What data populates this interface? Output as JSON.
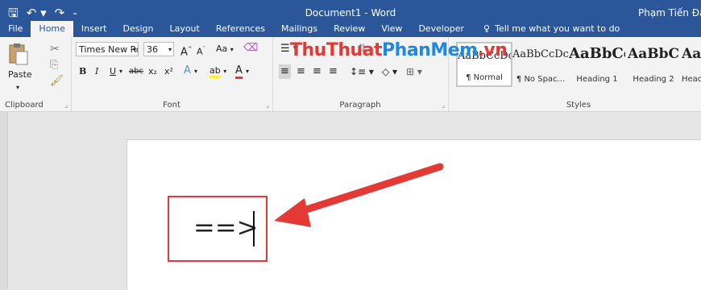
{
  "window": {
    "doc_title": "Document1 - Word",
    "user": "Phạm Tiến Đạt"
  },
  "tabs": [
    {
      "label": "File",
      "active": false
    },
    {
      "label": "Home",
      "active": true
    },
    {
      "label": "Insert",
      "active": false
    },
    {
      "label": "Design",
      "active": false
    },
    {
      "label": "Layout",
      "active": false
    },
    {
      "label": "References",
      "active": false
    },
    {
      "label": "Mailings",
      "active": false
    },
    {
      "label": "Review",
      "active": false
    },
    {
      "label": "View",
      "active": false
    },
    {
      "label": "Developer",
      "active": false
    }
  ],
  "tell_me": "Tell me what you want to do",
  "clipboard": {
    "label": "Clipboard",
    "paste": "Paste"
  },
  "font": {
    "label": "Font",
    "name": "Times New Ro",
    "size": "36",
    "grow": "A",
    "shrink": "A",
    "case": "Aa",
    "bold": "B",
    "italic": "I",
    "underline": "U",
    "strike": "abc",
    "subscript": "x₂",
    "superscript": "x²",
    "effects": "A",
    "highlight": "ab",
    "color": "A"
  },
  "paragraph": {
    "label": "Paragraph"
  },
  "styles": {
    "label": "Styles",
    "items": [
      {
        "preview": "AaBbCcDc",
        "name": "¶ Normal",
        "size": 13,
        "bold": false,
        "selected": true
      },
      {
        "preview": "AaBbCcDc",
        "name": "¶ No Spac...",
        "size": 13,
        "bold": false,
        "selected": false
      },
      {
        "preview": "AaBbCc",
        "name": "Heading 1",
        "size": 18,
        "bold": true,
        "selected": false
      },
      {
        "preview": "AaBbC",
        "name": "Heading 2",
        "size": 17,
        "bold": true,
        "selected": false
      },
      {
        "preview": "AaBbCcc",
        "name": "Heading",
        "size": 17,
        "bold": true,
        "selected": false
      }
    ]
  },
  "watermark": {
    "part1": "ThuThuat",
    "part2": "PhanMem",
    "part3": ".vn"
  },
  "document": {
    "text": "==>"
  },
  "colors": {
    "accent": "#2b579a",
    "highlight": "#e53935",
    "arrow": "#e53935"
  }
}
